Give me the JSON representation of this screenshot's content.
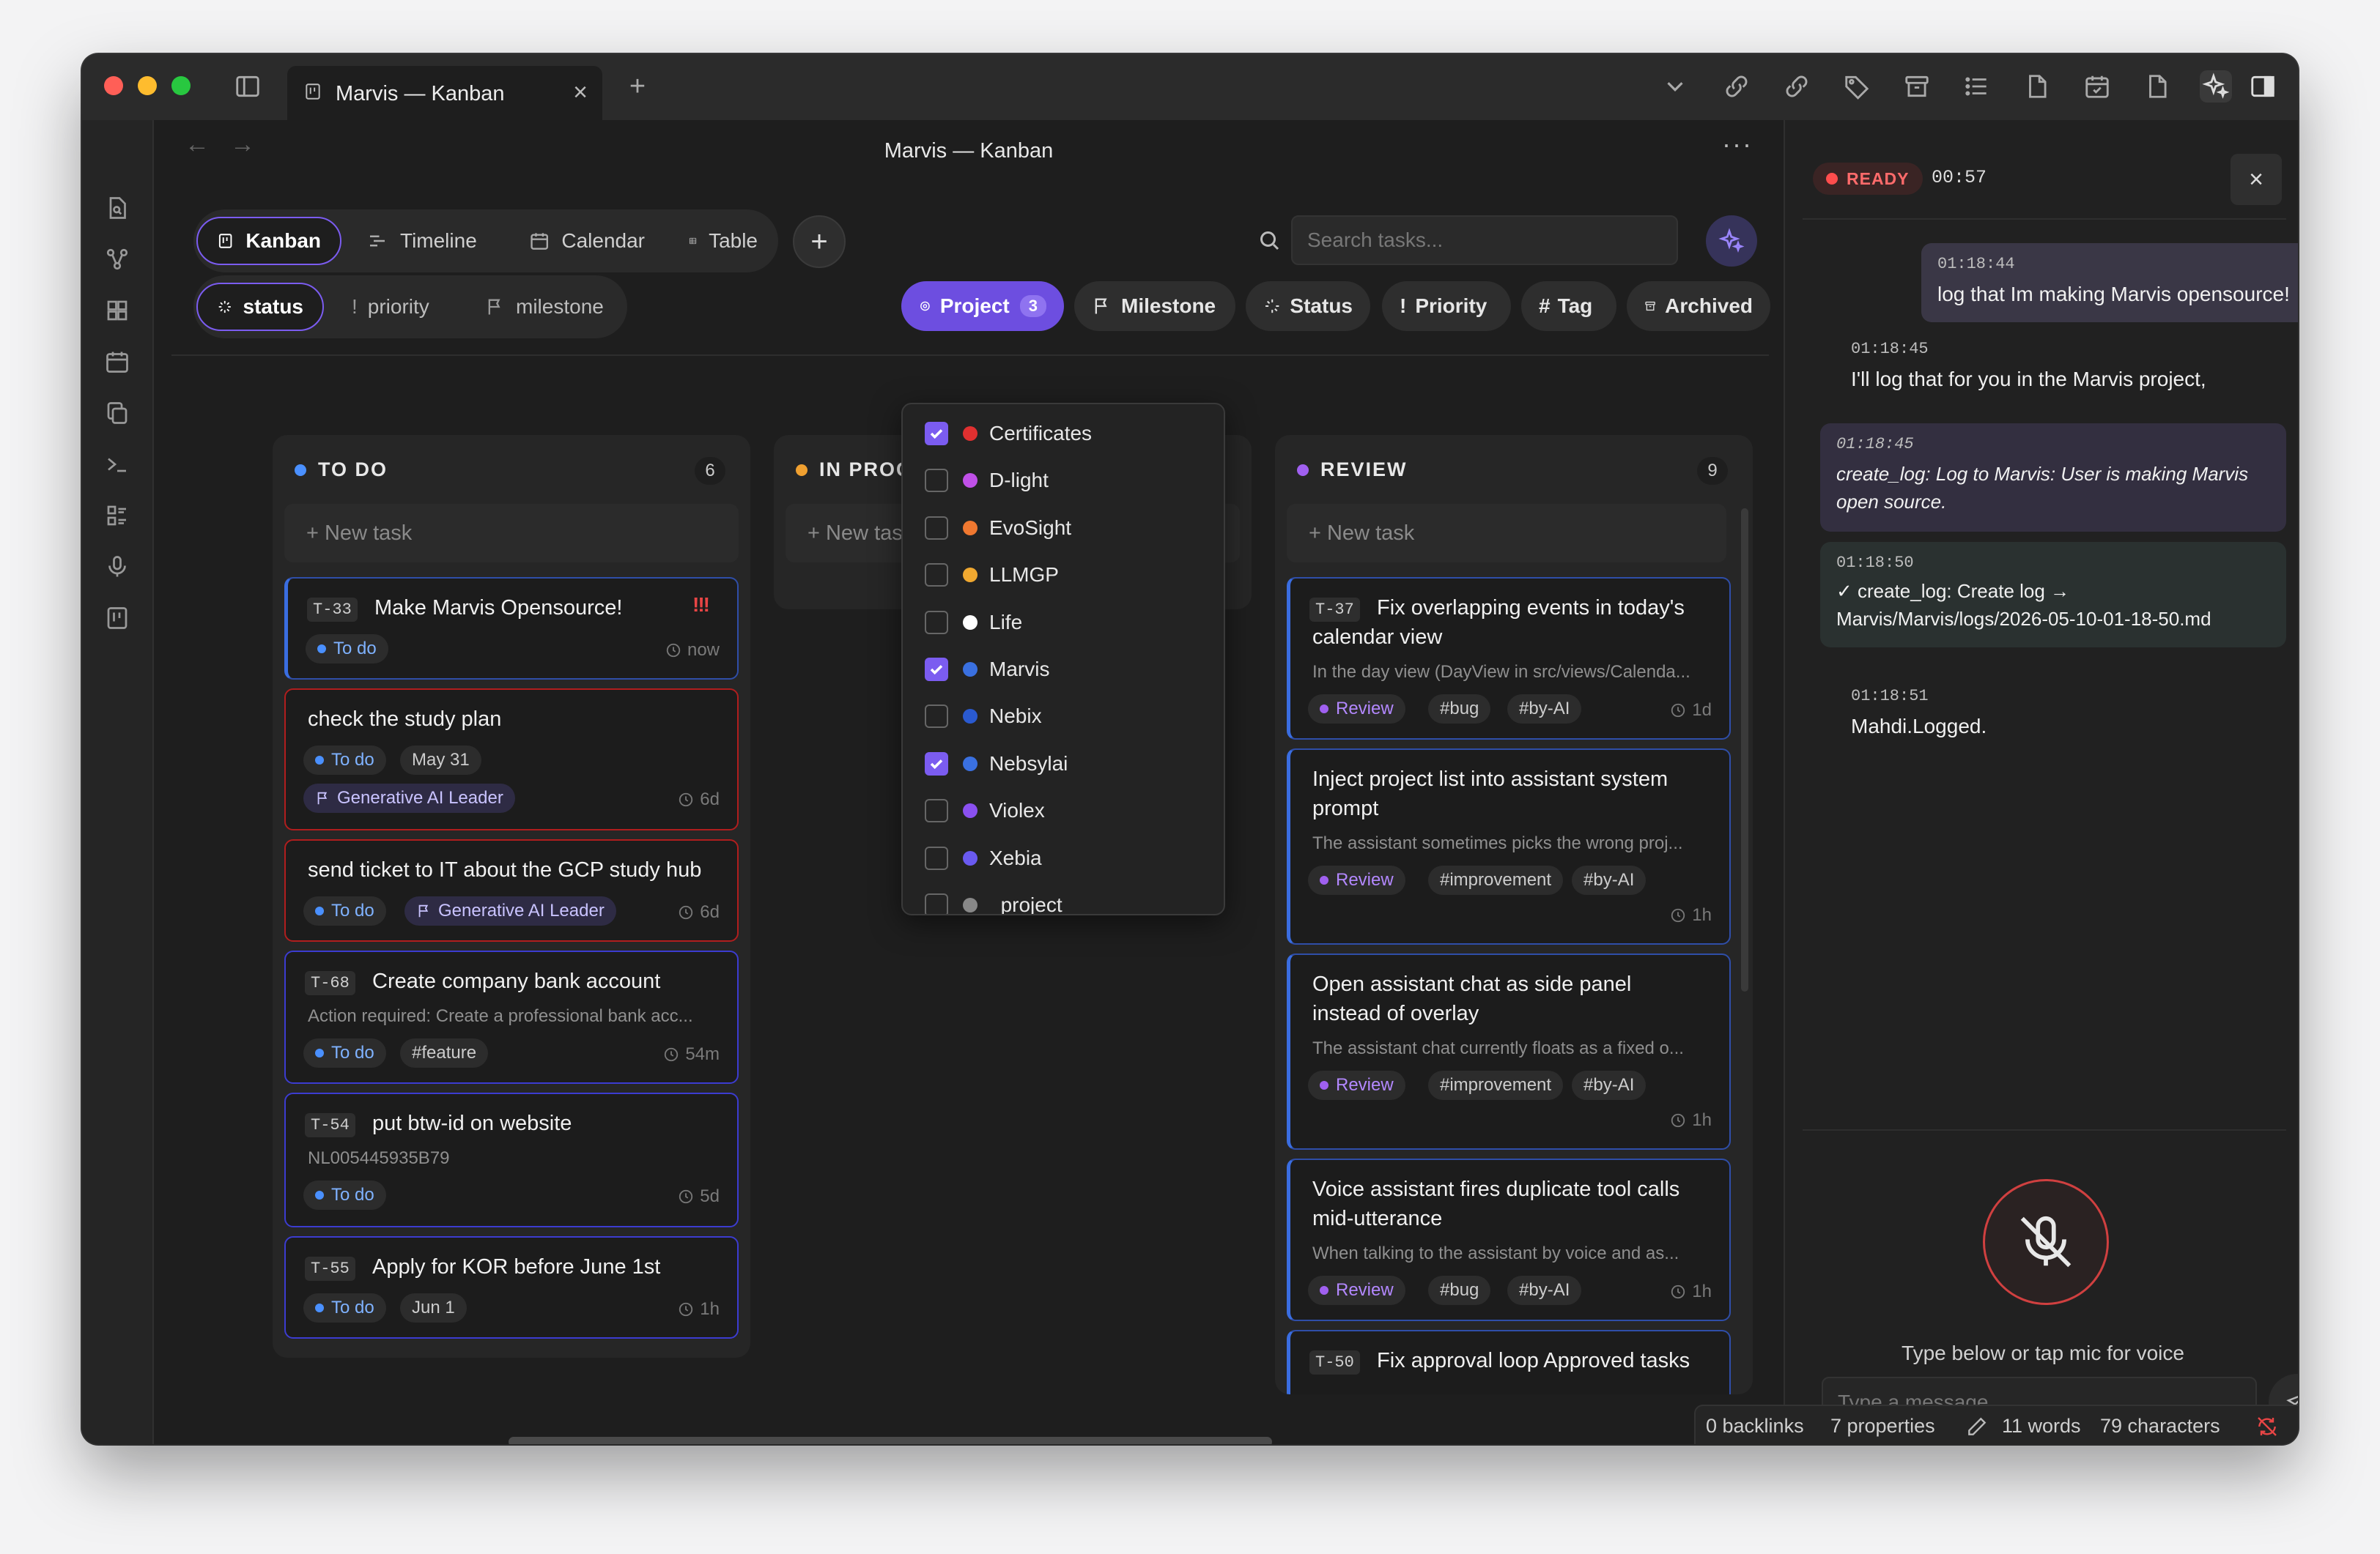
{
  "window": {
    "tab_title": "Marvis — Kanban",
    "page_title": "Marvis — Kanban",
    "traffic_lights": [
      "#ff5f57",
      "#febc2e",
      "#28c840"
    ],
    "tab_close": "×",
    "new_tab": "+",
    "more": "···"
  },
  "views": [
    {
      "label": "Kanban",
      "icon": "kanban-icon",
      "active": true
    },
    {
      "label": "Timeline",
      "icon": "timeline-icon",
      "active": false
    },
    {
      "label": "Calendar",
      "icon": "calendar-icon",
      "active": false
    },
    {
      "label": "Table",
      "icon": "table-icon",
      "active": false
    }
  ],
  "add_view": "+",
  "search": {
    "placeholder": "Search tasks..."
  },
  "group_by": [
    {
      "label": "status",
      "active": true
    },
    {
      "label": "priority",
      "active": false
    },
    {
      "label": "milestone",
      "active": false
    }
  ],
  "filters": {
    "project": {
      "label": "Project",
      "count": "3"
    },
    "milestone": "Milestone",
    "status": "Status",
    "priority": "Priority",
    "tag": "Tag",
    "archived": "Archived"
  },
  "project_dropdown": [
    {
      "name": "Certificates",
      "checked": true,
      "color": "#e03030"
    },
    {
      "name": "D-light",
      "checked": false,
      "color": "#c050e8"
    },
    {
      "name": "EvoSight",
      "checked": false,
      "color": "#f07830"
    },
    {
      "name": "LLMGP",
      "checked": false,
      "color": "#f0a830"
    },
    {
      "name": "Life",
      "checked": false,
      "color": "#ffffff"
    },
    {
      "name": "Marvis",
      "checked": true,
      "color": "#3a70e0"
    },
    {
      "name": "Nebix",
      "checked": false,
      "color": "#2a5ad0"
    },
    {
      "name": "Nebsylai",
      "checked": true,
      "color": "#3a70e0"
    },
    {
      "name": "Violex",
      "checked": false,
      "color": "#8a50f0"
    },
    {
      "name": "Xebia",
      "checked": false,
      "color": "#6a5af0"
    },
    {
      "name": "_project",
      "checked": false,
      "color": "#888888"
    }
  ],
  "columns": {
    "todo": {
      "title": "TO DO",
      "count": "6",
      "color": "#4a90ff",
      "new_task": "+ New task",
      "cards": [
        {
          "id": "T-33",
          "title": "Make Marvis Opensource!",
          "status": "To do",
          "priority": "!!!",
          "age": "now"
        },
        {
          "title": "check the study plan",
          "status": "To do",
          "date": "May 31",
          "milestone": "Generative AI Leader",
          "age": "6d"
        },
        {
          "title": "send ticket to IT about the GCP study hub",
          "status": "To do",
          "milestone": "Generative AI Leader",
          "age": "6d"
        },
        {
          "id": "T-68",
          "title": "Create company bank account",
          "desc": "Action required: Create a professional bank acc...",
          "status": "To do",
          "tag": "#feature",
          "age": "54m"
        },
        {
          "id": "T-54",
          "title": "put btw-id on website",
          "desc": "NL005445935B79",
          "status": "To do",
          "age": "5d"
        },
        {
          "id": "T-55",
          "title": "Apply for KOR before June 1st",
          "status": "To do",
          "date": "Jun 1",
          "age": "1h"
        }
      ]
    },
    "inprogress": {
      "title": "IN PROG",
      "color": "#f0a030",
      "new_task": "+ New tas"
    },
    "review": {
      "title": "REVIEW",
      "count": "9",
      "color": "#a060f0",
      "new_task": "+ New task",
      "cards": [
        {
          "id": "T-37",
          "title_line1": "Fix overlapping events in today's",
          "title_line2": "calendar view",
          "desc": "In the day view (DayView in src/views/Calenda...",
          "status": "Review",
          "tags": [
            "#bug",
            "#by-AI"
          ],
          "age": "1d"
        },
        {
          "title_line1": "Inject project list into assistant system",
          "title_line2": "prompt",
          "desc": "The assistant sometimes picks the wrong proj...",
          "status": "Review",
          "tags": [
            "#improvement",
            "#by-AI"
          ],
          "age": "1h"
        },
        {
          "title_line1": "Open assistant chat as side panel",
          "title_line2": "instead of overlay",
          "desc": "The assistant chat currently floats as a fixed o...",
          "status": "Review",
          "tags": [
            "#improvement",
            "#by-AI"
          ],
          "age": "1h"
        },
        {
          "title_line1": "Voice assistant fires duplicate tool calls",
          "title_line2": "mid-utterance",
          "desc": "When talking to the assistant by voice and as...",
          "status": "Review",
          "tags": [
            "#bug",
            "#by-AI"
          ],
          "age": "1h"
        },
        {
          "id": "T-50",
          "title_line1": "Fix approval loop Approved tasks"
        }
      ]
    }
  },
  "assistant": {
    "status": "READY",
    "timer": "00:57",
    "close": "×",
    "messages": [
      {
        "time": "01:18:44",
        "text": "log that Im making Marvis opensource!"
      },
      {
        "time": "01:18:45",
        "text": "I'll log that for you in the Marvis project,"
      },
      {
        "time": "01:18:45",
        "line1": "create_log: Log to Marvis: User is making Marvis",
        "line2": "open source."
      },
      {
        "time": "01:18:50",
        "line1": "✓ create_log: Create log →",
        "line2": "Marvis/Marvis/logs/2026-05-10-01-18-50.md"
      },
      {
        "time": "01:18:51",
        "text": "Mahdi.Logged."
      }
    ],
    "mic_hint": "Type below or tap mic for voice",
    "input_placeholder": "Type a message..."
  },
  "statusbar": {
    "backlinks": "0 backlinks",
    "properties": "7 properties",
    "words": "11 words",
    "characters": "79 characters"
  },
  "colors": {
    "accent": "#7b5cf0",
    "todo": "#4a90ff",
    "review": "#a060f0",
    "danger": "#e84545"
  }
}
